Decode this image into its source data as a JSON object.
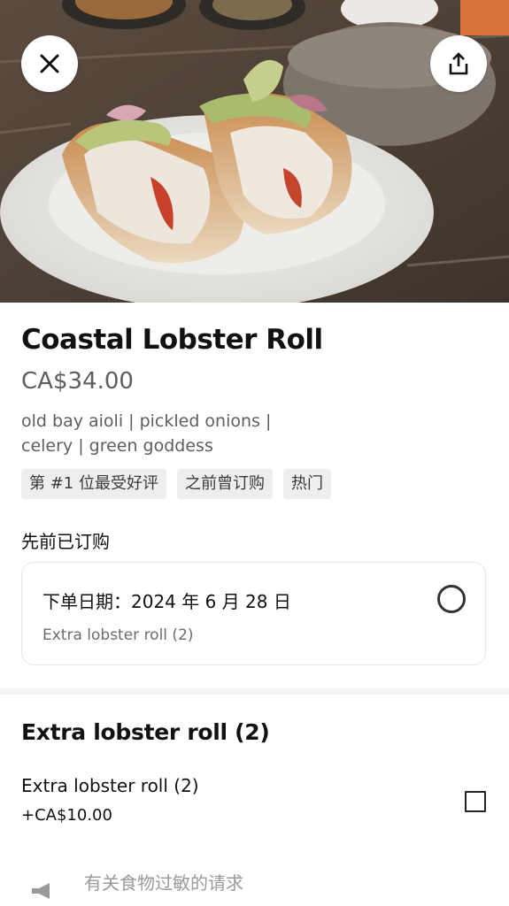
{
  "item": {
    "name": "Coastal Lobster Roll",
    "price": "CA$34.00",
    "description": "old bay aioli | pickled onions | celery | green goddess",
    "badges": [
      "第 #1 位最受好评",
      "之前曾订购",
      "热门"
    ]
  },
  "previous_orders": {
    "heading": "先前已订购",
    "order": {
      "date_label": "下单日期：2024 年 6 月 28 日",
      "items": "Extra lobster roll (2)"
    }
  },
  "options": {
    "group_title": "Extra lobster roll (2)",
    "option": {
      "label": "Extra lobster roll (2)",
      "price": "+CA$10.00",
      "checked": false
    }
  },
  "allergy": {
    "label": "有关食物过敏的请求"
  },
  "icons": {
    "close": "close-icon",
    "share": "share-icon",
    "allergy": "megaphone-icon"
  },
  "colors": {
    "background": "#ffffff",
    "badge_bg": "#eeeeee",
    "secondary_text": "#5e5e5e"
  }
}
